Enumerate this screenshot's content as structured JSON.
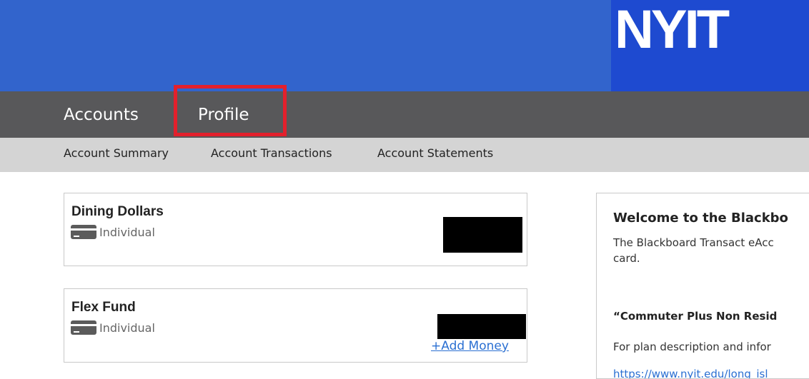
{
  "header": {
    "logo_text": "NYIT",
    "brand_color": "#3264cc"
  },
  "main_nav": {
    "items": [
      {
        "label": "Accounts"
      },
      {
        "label": "Profile"
      }
    ],
    "highlight_color": "#e3202c"
  },
  "sub_nav": {
    "items": [
      {
        "label": "Account Summary"
      },
      {
        "label": "Account Transactions"
      },
      {
        "label": "Account Statements"
      }
    ]
  },
  "accounts": [
    {
      "name": "Dining Dollars",
      "type": "Individual",
      "type_icon": "credit-card-icon",
      "balance_redacted": true
    },
    {
      "name": "Flex Fund",
      "type": "Individual",
      "type_icon": "credit-card-icon",
      "balance_redacted": true,
      "action_label": "+Add Money"
    }
  ],
  "welcome": {
    "title": "Welcome to the Blackbo",
    "body": "The Blackboard Transact eAcc\ncard.",
    "subheading": "“Commuter Plus Non Resid",
    "info": "For plan description and infor",
    "link": "https://www.nyit.edu/long_isl"
  }
}
